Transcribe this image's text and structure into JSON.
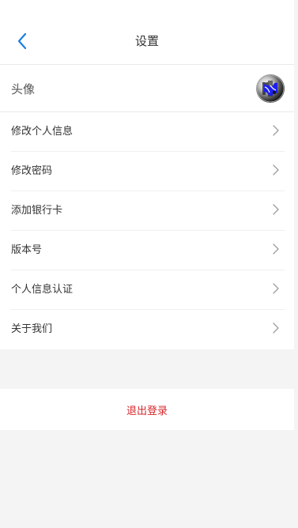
{
  "header": {
    "title": "设置"
  },
  "avatar_row": {
    "label": "头像"
  },
  "menu_items": [
    {
      "label": "修改个人信息"
    },
    {
      "label": "修改密码"
    },
    {
      "label": "添加银行卡"
    },
    {
      "label": "版本号"
    },
    {
      "label": "个人信息认证"
    },
    {
      "label": "关于我们"
    }
  ],
  "logout": {
    "label": "退出登录"
  },
  "colors": {
    "accent": "#1b7fe0",
    "logout": "#d7262b"
  },
  "icons": {
    "back": "back-chevron-icon",
    "chevron": "chevron-right-icon",
    "avatar": "user-avatar"
  }
}
